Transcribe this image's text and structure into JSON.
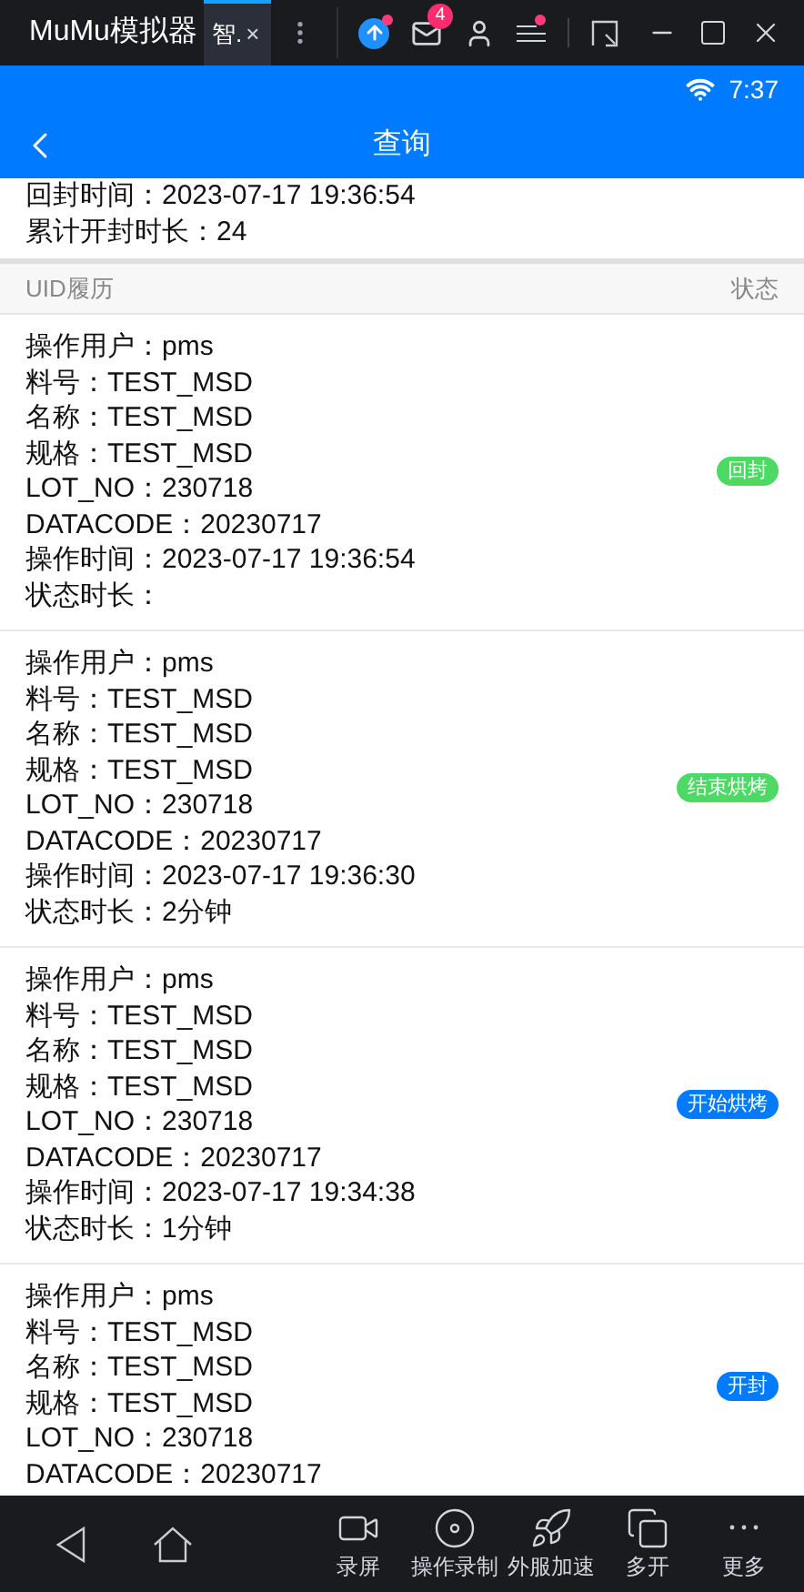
{
  "window": {
    "title": "MuMu模拟器",
    "tab": {
      "label": "智.",
      "close": "×"
    },
    "mail_count": "4"
  },
  "status_bar": {
    "time": "7:37"
  },
  "nav": {
    "title": "查询"
  },
  "summary": [
    {
      "label": "回封时间：",
      "value": "2023-07-17 19:36:54"
    },
    {
      "label": "累计开封时长：",
      "value": "24"
    }
  ],
  "history_header": {
    "left": "UID履历",
    "right": "状态"
  },
  "records": [
    {
      "lines": [
        "操作用户：pms",
        "料号：TEST_MSD",
        "名称：TEST_MSD",
        "规格：TEST_MSD",
        "LOT_NO：230718",
        "DATACODE：20230717",
        "操作时间：2023-07-17 19:36:54",
        "状态时长："
      ],
      "status": {
        "label": "回封",
        "color": "#4cd964"
      }
    },
    {
      "lines": [
        "操作用户：pms",
        "料号：TEST_MSD",
        "名称：TEST_MSD",
        "规格：TEST_MSD",
        "LOT_NO：230718",
        "DATACODE：20230717",
        "操作时间：2023-07-17 19:36:30",
        "状态时长：2分钟"
      ],
      "status": {
        "label": "结束烘烤",
        "color": "#4cd964"
      }
    },
    {
      "lines": [
        "操作用户：pms",
        "料号：TEST_MSD",
        "名称：TEST_MSD",
        "规格：TEST_MSD",
        "LOT_NO：230718",
        "DATACODE：20230717",
        "操作时间：2023-07-17 19:34:38",
        "状态时长：1分钟"
      ],
      "status": {
        "label": "开始烘烤",
        "color": "#007aff"
      }
    },
    {
      "lines": [
        "操作用户：pms",
        "料号：TEST_MSD",
        "名称：TEST_MSD",
        "规格：TEST_MSD",
        "LOT_NO：230718",
        "DATACODE：20230717"
      ],
      "status": {
        "label": "开封",
        "color": "#007aff"
      }
    }
  ],
  "toolbar": [
    {
      "kind": "record",
      "label": "录屏"
    },
    {
      "kind": "macro",
      "label": "操作录制"
    },
    {
      "kind": "boost",
      "label": "外服加速"
    },
    {
      "kind": "multi",
      "label": "多开"
    },
    {
      "kind": "more",
      "label": "更多"
    }
  ]
}
